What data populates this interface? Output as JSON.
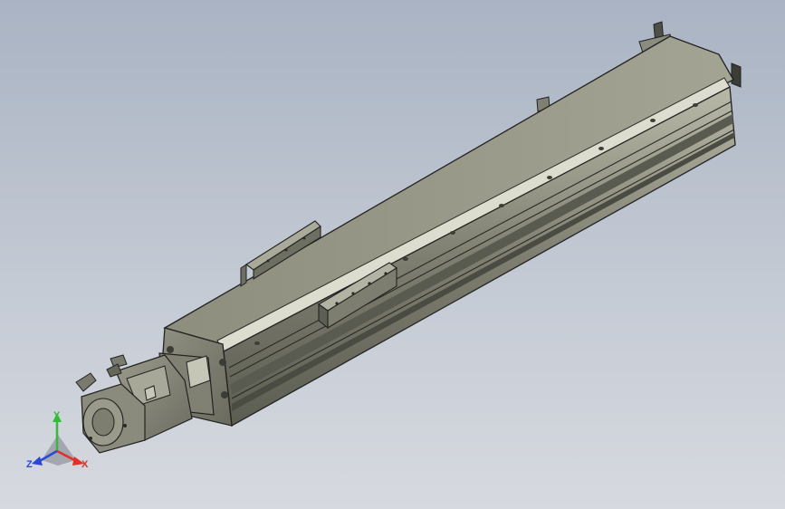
{
  "viewport": {
    "background_top": "#a9b3c3",
    "background_bottom": "#d6d9df"
  },
  "model": {
    "name_icon": "linear-actuator-model",
    "body_color": "#8d8e7d",
    "edge_color": "#2a2a26"
  },
  "triad": {
    "x_label": "X",
    "y_label": "Y",
    "z_label": "Z",
    "x_color": "#e0302a",
    "y_color": "#2fbf34",
    "z_color": "#2a48d8"
  }
}
